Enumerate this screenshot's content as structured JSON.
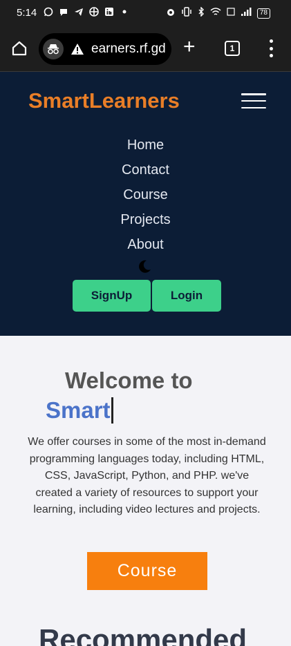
{
  "status_bar": {
    "time": "5:14",
    "battery": "78"
  },
  "browser": {
    "url": "earners.rf.gd",
    "tab_count": "1"
  },
  "site": {
    "brand": "SmartLearners",
    "nav": [
      "Home",
      "Contact",
      "Course",
      "Projects",
      "About"
    ],
    "signup_label": "SignUp",
    "login_label": "Login"
  },
  "hero": {
    "heading": "Welcome to",
    "typed_text": "Smart",
    "intro": "We offer courses in some of the most in-demand programming languages today, including HTML, CSS, JavaScript, Python, and PHP. we've created a variety of resources to support your learning, including video lectures and projects.",
    "course_button": "Course"
  },
  "next_section_heading": "Recommended",
  "colors": {
    "header_bg": "#0c1d36",
    "brand": "#e97e27",
    "accent_green": "#3dd08a",
    "course_orange": "#f77f0e",
    "typed_blue": "#4b73c9"
  }
}
